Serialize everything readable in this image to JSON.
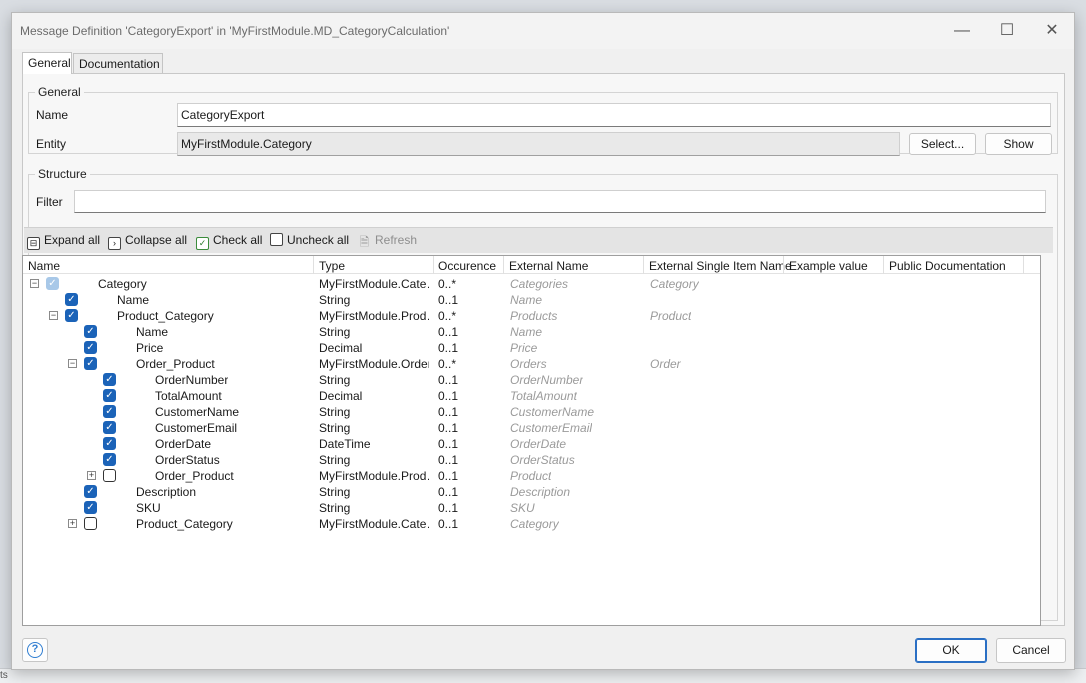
{
  "window": {
    "title": "Message Definition 'CategoryExport' in 'MyFirstModule.MD_CategoryCalculation'",
    "minimize": "—",
    "maximize": "☐",
    "close": "✕"
  },
  "tabs": [
    {
      "label": "General",
      "active": true
    },
    {
      "label": "Documentation",
      "active": false
    }
  ],
  "general": {
    "legend": "General",
    "name_label": "Name",
    "name_value": "CategoryExport",
    "entity_label": "Entity",
    "entity_value": "MyFirstModule.Category",
    "select_button": "Select...",
    "show_button": "Show"
  },
  "structure": {
    "legend": "Structure",
    "filter_label": "Filter",
    "filter_value": "",
    "toolbar": {
      "expand_all": "Expand all",
      "collapse_all": "Collapse all",
      "check_all": "Check all",
      "uncheck_all": "Uncheck all",
      "refresh": "Refresh"
    },
    "columns": [
      "Name",
      "Type",
      "Occurence",
      "External Name",
      "External Single Item Name",
      "Example value",
      "Public Documentation"
    ],
    "rows": [
      {
        "level": 0,
        "expander": "minus",
        "checked": "dim",
        "name": "Category",
        "type": "MyFirstModule.Cate…",
        "occurrence": "0..*",
        "external_name": "Categories",
        "single_item": "Category"
      },
      {
        "level": 1,
        "expander": "",
        "checked": "on",
        "name": "Name",
        "type": "String",
        "occurrence": "0..1",
        "external_name": "Name",
        "single_item": ""
      },
      {
        "level": 1,
        "expander": "minus",
        "checked": "on",
        "name": "Product_Category",
        "type": "MyFirstModule.Prod…",
        "occurrence": "0..*",
        "external_name": "Products",
        "single_item": "Product"
      },
      {
        "level": 2,
        "expander": "",
        "checked": "on",
        "name": "Name",
        "type": "String",
        "occurrence": "0..1",
        "external_name": "Name",
        "single_item": ""
      },
      {
        "level": 2,
        "expander": "",
        "checked": "on",
        "name": "Price",
        "type": "Decimal",
        "occurrence": "0..1",
        "external_name": "Price",
        "single_item": ""
      },
      {
        "level": 2,
        "expander": "minus",
        "checked": "on",
        "name": "Order_Product",
        "type": "MyFirstModule.Order",
        "occurrence": "0..*",
        "external_name": "Orders",
        "single_item": "Order"
      },
      {
        "level": 3,
        "expander": "",
        "checked": "on",
        "name": "OrderNumber",
        "type": "String",
        "occurrence": "0..1",
        "external_name": "OrderNumber",
        "single_item": ""
      },
      {
        "level": 3,
        "expander": "",
        "checked": "on",
        "name": "TotalAmount",
        "type": "Decimal",
        "occurrence": "0..1",
        "external_name": "TotalAmount",
        "single_item": ""
      },
      {
        "level": 3,
        "expander": "",
        "checked": "on",
        "name": "CustomerName",
        "type": "String",
        "occurrence": "0..1",
        "external_name": "CustomerName",
        "single_item": ""
      },
      {
        "level": 3,
        "expander": "",
        "checked": "on",
        "name": "CustomerEmail",
        "type": "String",
        "occurrence": "0..1",
        "external_name": "CustomerEmail",
        "single_item": ""
      },
      {
        "level": 3,
        "expander": "",
        "checked": "on",
        "name": "OrderDate",
        "type": "DateTime",
        "occurrence": "0..1",
        "external_name": "OrderDate",
        "single_item": ""
      },
      {
        "level": 3,
        "expander": "",
        "checked": "on",
        "name": "OrderStatus",
        "type": "String",
        "occurrence": "0..1",
        "external_name": "OrderStatus",
        "single_item": ""
      },
      {
        "level": 3,
        "expander": "plus",
        "checked": "off",
        "name": "Order_Product",
        "type": "MyFirstModule.Prod…",
        "occurrence": "0..1",
        "external_name": "Product",
        "single_item": ""
      },
      {
        "level": 2,
        "expander": "",
        "checked": "on",
        "name": "Description",
        "type": "String",
        "occurrence": "0..1",
        "external_name": "Description",
        "single_item": ""
      },
      {
        "level": 2,
        "expander": "",
        "checked": "on",
        "name": "SKU",
        "type": "String",
        "occurrence": "0..1",
        "external_name": "SKU",
        "single_item": ""
      },
      {
        "level": 2,
        "expander": "plus",
        "checked": "off",
        "name": "Product_Category",
        "type": "MyFirstModule.Cate…",
        "occurrence": "0..1",
        "external_name": "Category",
        "single_item": ""
      }
    ]
  },
  "footer": {
    "help": "?",
    "ok": "OK",
    "cancel": "Cancel"
  },
  "background": {
    "left_fragment": "ts"
  }
}
